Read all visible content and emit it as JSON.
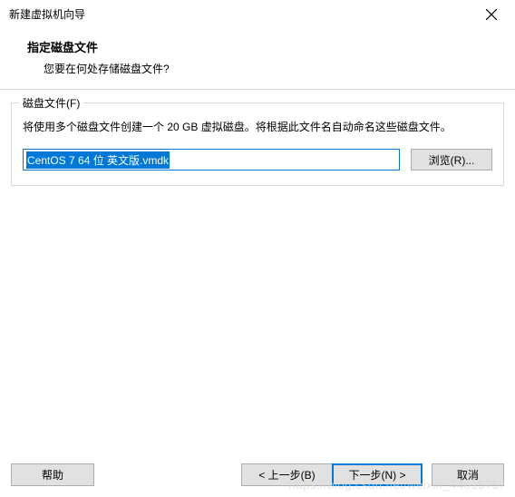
{
  "titlebar": {
    "title": "新建虚拟机向导"
  },
  "header": {
    "title": "指定磁盘文件",
    "subtitle": "您要在何处存储磁盘文件?"
  },
  "fieldset": {
    "legend": "磁盘文件(F)",
    "description": "将使用多个磁盘文件创建一个 20 GB 虚拟磁盘。将根据此文件名自动命名这些磁盘文件。",
    "input_value": "CentOS 7 64 位 英文版.vmdk",
    "browse_label": "浏览(R)..."
  },
  "footer": {
    "help": "帮助",
    "back": "< 上一步(B)",
    "next": "下一步(N) >",
    "cancel": "取消"
  },
  "watermark": "https://blog.csdn.net/weixin_44015757"
}
